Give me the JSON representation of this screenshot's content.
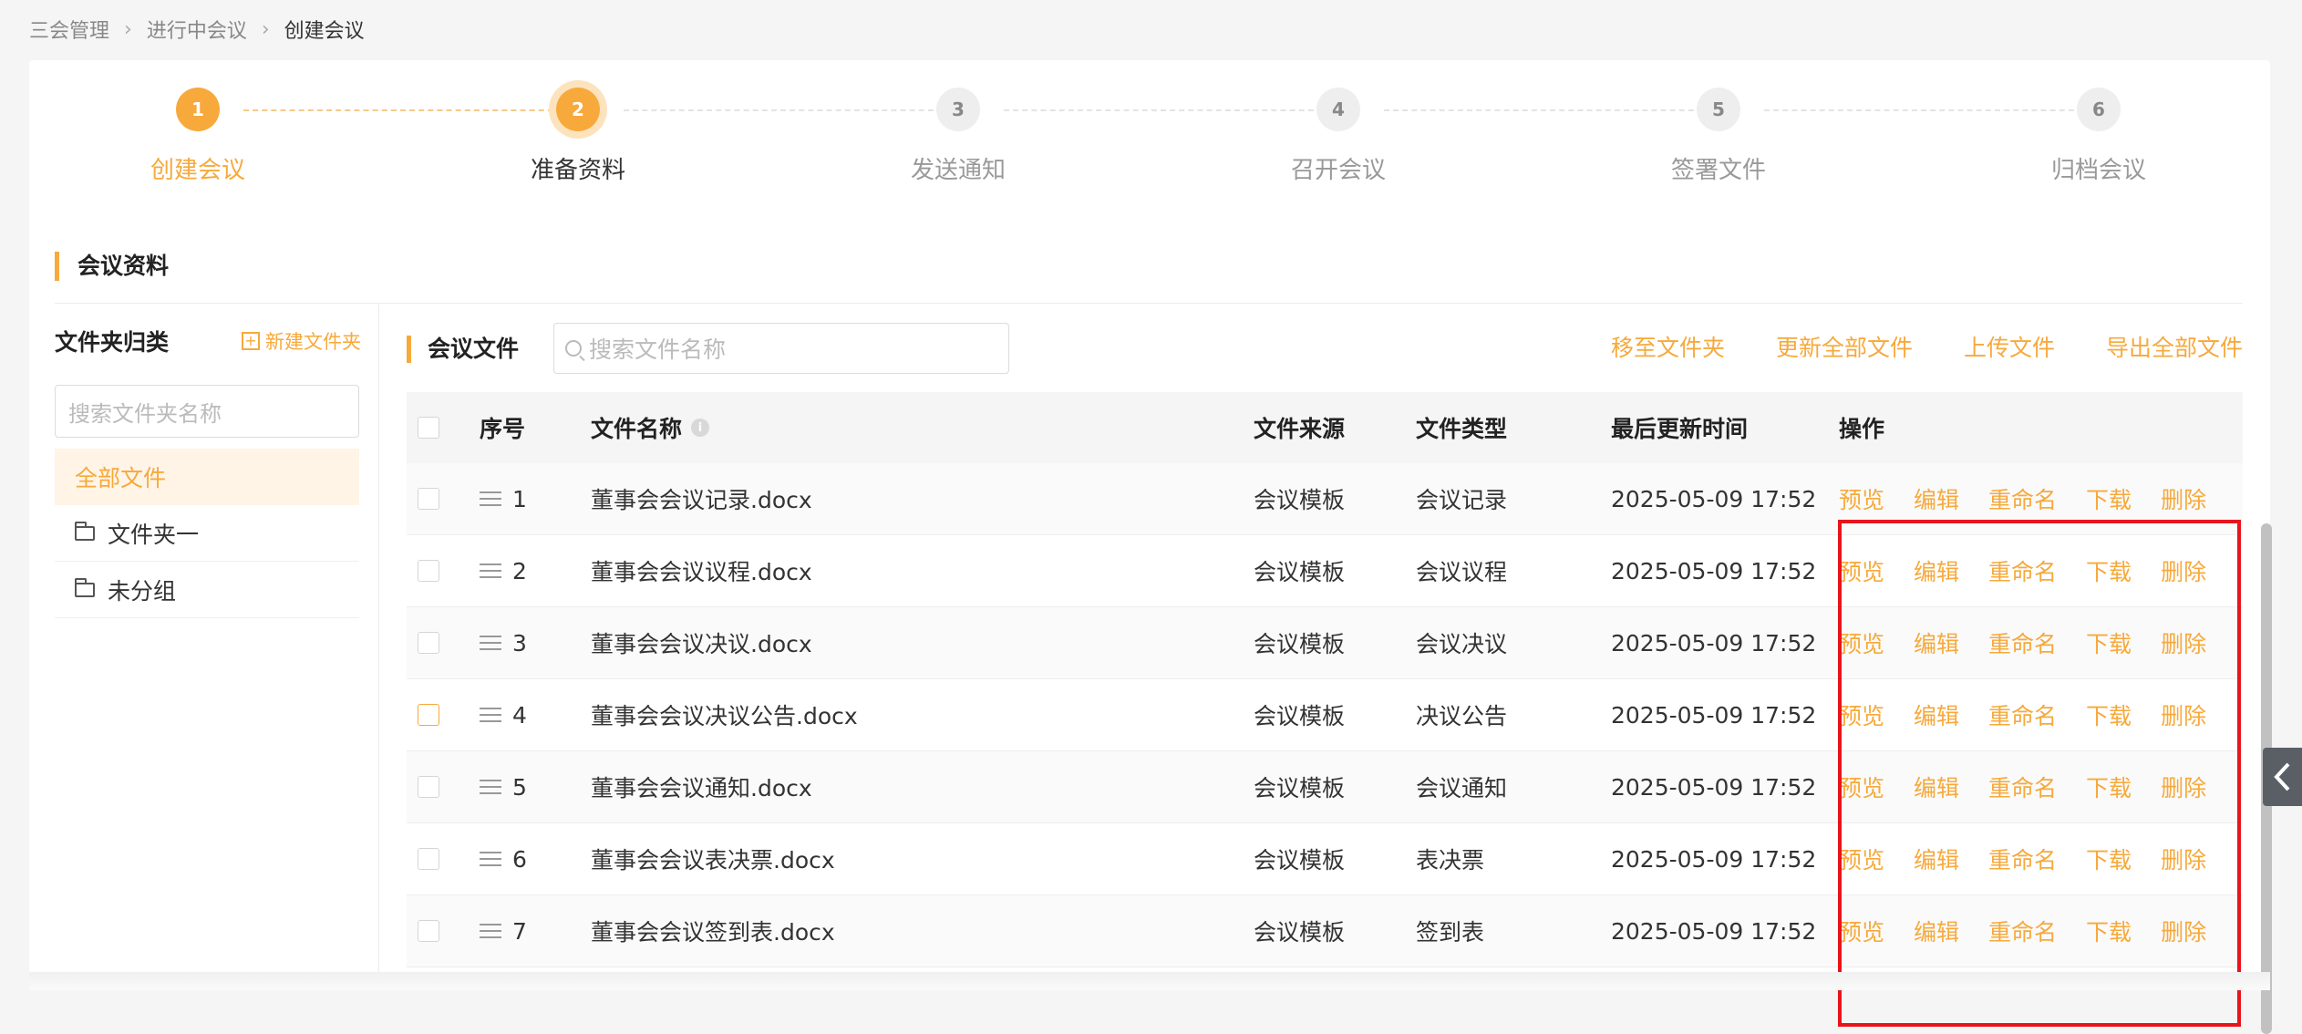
{
  "breadcrumb": [
    "三会管理",
    "进行中会议",
    "创建会议"
  ],
  "steps": [
    {
      "num": "1",
      "label": "创建会议"
    },
    {
      "num": "2",
      "label": "准备资料"
    },
    {
      "num": "3",
      "label": "发送通知"
    },
    {
      "num": "4",
      "label": "召开会议"
    },
    {
      "num": "5",
      "label": "签署文件"
    },
    {
      "num": "6",
      "label": "归档会议"
    }
  ],
  "section_title": "会议资料",
  "folder_panel": {
    "title": "文件夹归类",
    "new_folder": "新建文件夹",
    "search_placeholder": "搜索文件夹名称",
    "items": [
      "全部文件",
      "文件夹一",
      "未分组"
    ]
  },
  "files_panel": {
    "title": "会议文件",
    "search_placeholder": "搜索文件名称",
    "toolbar": [
      "移至文件夹",
      "更新全部文件",
      "上传文件",
      "导出全部文件"
    ],
    "columns": [
      "序号",
      "文件名称",
      "文件来源",
      "文件类型",
      "最后更新时间",
      "操作"
    ],
    "ops": [
      "预览",
      "编辑",
      "重命名",
      "下载",
      "删除"
    ],
    "rows": [
      {
        "seq": "1",
        "name": "董事会会议记录.docx",
        "source": "会议模板",
        "type": "会议记录",
        "time": "2025-05-09 17:52"
      },
      {
        "seq": "2",
        "name": "董事会会议议程.docx",
        "source": "会议模板",
        "type": "会议议程",
        "time": "2025-05-09 17:52"
      },
      {
        "seq": "3",
        "name": "董事会会议决议.docx",
        "source": "会议模板",
        "type": "会议决议",
        "time": "2025-05-09 17:52"
      },
      {
        "seq": "4",
        "name": "董事会会议决议公告.docx",
        "source": "会议模板",
        "type": "决议公告",
        "time": "2025-05-09 17:52"
      },
      {
        "seq": "5",
        "name": "董事会会议通知.docx",
        "source": "会议模板",
        "type": "会议通知",
        "time": "2025-05-09 17:52"
      },
      {
        "seq": "6",
        "name": "董事会会议表决票.docx",
        "source": "会议模板",
        "type": "表决票",
        "time": "2025-05-09 17:52"
      },
      {
        "seq": "7",
        "name": "董事会会议签到表.docx",
        "source": "会议模板",
        "type": "签到表",
        "time": "2025-05-09 17:52"
      }
    ]
  },
  "colors": {
    "accent": "#f7a93b",
    "highlight": "#e8141c"
  }
}
